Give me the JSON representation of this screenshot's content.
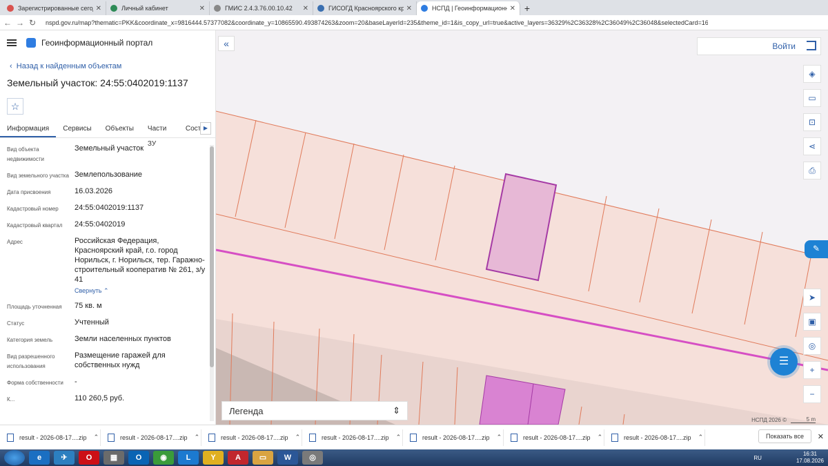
{
  "tabs": [
    {
      "title": "Зарегистрированные сегодня",
      "color": "#d9534f"
    },
    {
      "title": "Личный кабинет",
      "color": "#2e8b57"
    },
    {
      "title": "ГМИС 2.4.3.76.00.10.42",
      "color": "#555555"
    },
    {
      "title": "ГИСОГД Красноярского края",
      "color": "#3a6fb0"
    },
    {
      "title": "НСПД | Геоинформационный п...",
      "color": "#2f7de1",
      "active": true
    }
  ],
  "browser": {
    "url": "nspd.gov.ru/map?thematic=PKK&coordinate_x=9816444.57377082&coordinate_y=10865590.493874263&zoom=20&baseLayerId=235&theme_id=1&is_copy_url=true&active_layers=36329%2C36328%2C36049%2C36048&selectedCard=1692..."
  },
  "panel": {
    "app_title": "Геоинформационный портал",
    "back_label": "Назад к найденным объектам",
    "title": "Земельный участок: 24:55:0402019:1137",
    "tabs": [
      "Информация",
      "Сервисы",
      "Объекты",
      "Части ЗУ",
      "Состав"
    ],
    "rows": [
      {
        "label": "Вид объекта недвижимости",
        "value": "Земельный участок"
      },
      {
        "label": "Вид земельного участка",
        "value": "Землепользование"
      },
      {
        "label": "Дата присвоения",
        "value": "16.03.2026"
      },
      {
        "label": "Кадастровый номер",
        "value": "24:55:0402019:1137"
      },
      {
        "label": "Кадастровый квартал",
        "value": "24:55:0402019"
      },
      {
        "label": "Адрес",
        "value": "Российская Федерация, Красноярский край, г.о. город Норильск, г. Норильск, тер. Гаражно-строительный кооператив № 261, з/у 41"
      },
      {
        "label": "Площадь уточненная",
        "value": "75 кв. м"
      },
      {
        "label": "Статус",
        "value": "Учтенный"
      },
      {
        "label": "Категория земель",
        "value": "Земли населенных пунктов"
      },
      {
        "label": "Вид разрешенного использования",
        "value": "Размещение гаражей для собственных нужд"
      },
      {
        "label": "Форма собственности",
        "value": "-"
      },
      {
        "label": "К...",
        "value": "110 260,5 руб."
      }
    ],
    "collapse_label": "Свернуть"
  },
  "map": {
    "login_label": "Войти",
    "legend_label": "Легенда",
    "copyright": "НСПД 2026 ©",
    "scale_label": "5 m",
    "colors": {
      "parcel_line": "#e07a5a",
      "parcel_fill": "#f6e0da",
      "selected": "#e7b8d6",
      "road": "#d64fc4",
      "highlight": "#d983d2"
    }
  },
  "downloads": {
    "items": [
      "result - 2026-08-17....zip",
      "result - 2026-08-17....zip",
      "result - 2026-08-17....zip",
      "result - 2026-08-17....zip",
      "result - 2026-08-17....zip",
      "result - 2026-08-17....zip",
      "result - 2026-08-17....zip"
    ],
    "show_all": "Показать все"
  },
  "taskbar": {
    "lang": "RU",
    "time": "16:31",
    "date": "17.08.2026"
  }
}
